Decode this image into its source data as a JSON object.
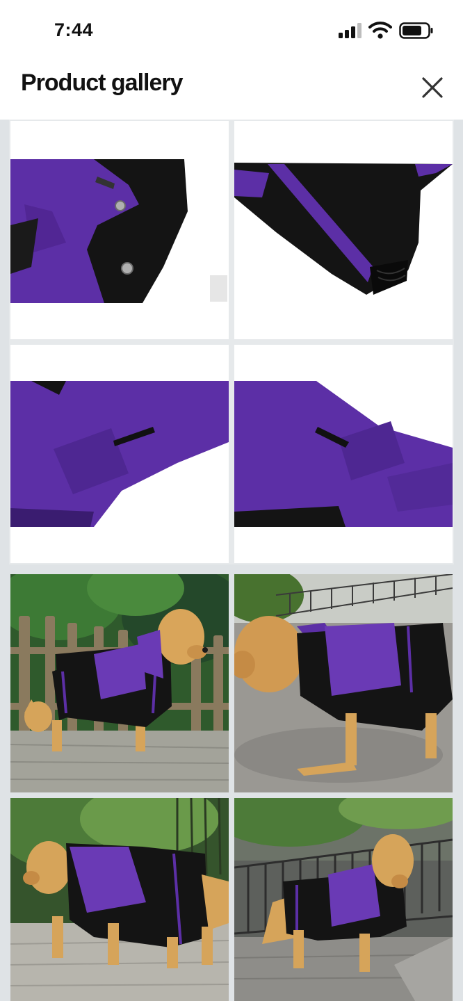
{
  "status_bar": {
    "time": "7:44",
    "icons": [
      "cellular-signal-icon",
      "wifi-icon",
      "battery-icon"
    ]
  },
  "header": {
    "title": "Product gallery",
    "close_icon": "close-icon"
  },
  "colors": {
    "accent_purple": "#5a2fa0",
    "fabric_black": "#141414",
    "header_bg": "#ffffff",
    "gallery_bg": "#dfe3e6"
  },
  "gallery": {
    "images": [
      {
        "id": "detail-collar-snaps"
      },
      {
        "id": "detail-sleeve-cuff"
      },
      {
        "id": "detail-side-pocket-left"
      },
      {
        "id": "detail-side-pocket-right"
      },
      {
        "id": "dog-by-wooden-fence"
      },
      {
        "id": "dog-on-path-side-view"
      },
      {
        "id": "dog-by-bamboo-walking"
      },
      {
        "id": "dog-by-iron-fence-standing"
      }
    ]
  }
}
